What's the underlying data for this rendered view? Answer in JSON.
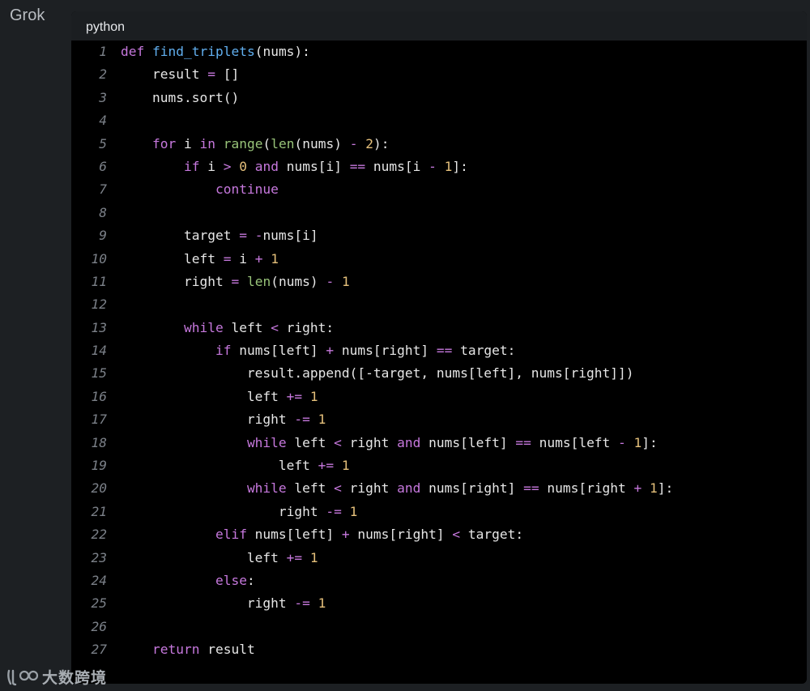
{
  "app": {
    "title": "Grok"
  },
  "code_block": {
    "language": "python",
    "lines": [
      {
        "n": "1",
        "tokens": [
          [
            "kw",
            "def"
          ],
          [
            "plain",
            " "
          ],
          [
            "fn",
            "find_triplets"
          ],
          [
            "plain",
            "(nums):"
          ]
        ]
      },
      {
        "n": "2",
        "tokens": [
          [
            "plain",
            "    result "
          ],
          [
            "op",
            "="
          ],
          [
            "plain",
            " []"
          ]
        ]
      },
      {
        "n": "3",
        "tokens": [
          [
            "plain",
            "    nums.sort()"
          ]
        ]
      },
      {
        "n": "4",
        "tokens": []
      },
      {
        "n": "5",
        "tokens": [
          [
            "plain",
            "    "
          ],
          [
            "kw",
            "for"
          ],
          [
            "plain",
            " i "
          ],
          [
            "kw",
            "in"
          ],
          [
            "plain",
            " "
          ],
          [
            "bi",
            "range"
          ],
          [
            "plain",
            "("
          ],
          [
            "bi",
            "len"
          ],
          [
            "plain",
            "(nums) "
          ],
          [
            "op",
            "-"
          ],
          [
            "plain",
            " "
          ],
          [
            "num",
            "2"
          ],
          [
            "plain",
            "):"
          ]
        ]
      },
      {
        "n": "6",
        "tokens": [
          [
            "plain",
            "        "
          ],
          [
            "kw",
            "if"
          ],
          [
            "plain",
            " i "
          ],
          [
            "op",
            ">"
          ],
          [
            "plain",
            " "
          ],
          [
            "num",
            "0"
          ],
          [
            "plain",
            " "
          ],
          [
            "kw",
            "and"
          ],
          [
            "plain",
            " nums[i] "
          ],
          [
            "op",
            "=="
          ],
          [
            "plain",
            " nums[i "
          ],
          [
            "op",
            "-"
          ],
          [
            "plain",
            " "
          ],
          [
            "num",
            "1"
          ],
          [
            "plain",
            "]:"
          ]
        ]
      },
      {
        "n": "7",
        "tokens": [
          [
            "plain",
            "            "
          ],
          [
            "kw",
            "continue"
          ]
        ]
      },
      {
        "n": "8",
        "tokens": []
      },
      {
        "n": "9",
        "tokens": [
          [
            "plain",
            "        target "
          ],
          [
            "op",
            "="
          ],
          [
            "plain",
            " "
          ],
          [
            "op",
            "-"
          ],
          [
            "plain",
            "nums[i]"
          ]
        ]
      },
      {
        "n": "10",
        "tokens": [
          [
            "plain",
            "        left "
          ],
          [
            "op",
            "="
          ],
          [
            "plain",
            " i "
          ],
          [
            "op",
            "+"
          ],
          [
            "plain",
            " "
          ],
          [
            "num",
            "1"
          ]
        ]
      },
      {
        "n": "11",
        "tokens": [
          [
            "plain",
            "        right "
          ],
          [
            "op",
            "="
          ],
          [
            "plain",
            " "
          ],
          [
            "bi",
            "len"
          ],
          [
            "plain",
            "(nums) "
          ],
          [
            "op",
            "-"
          ],
          [
            "plain",
            " "
          ],
          [
            "num",
            "1"
          ]
        ]
      },
      {
        "n": "12",
        "tokens": []
      },
      {
        "n": "13",
        "tokens": [
          [
            "plain",
            "        "
          ],
          [
            "kw",
            "while"
          ],
          [
            "plain",
            " left "
          ],
          [
            "op",
            "<"
          ],
          [
            "plain",
            " right:"
          ]
        ]
      },
      {
        "n": "14",
        "tokens": [
          [
            "plain",
            "            "
          ],
          [
            "kw",
            "if"
          ],
          [
            "plain",
            " nums[left] "
          ],
          [
            "op",
            "+"
          ],
          [
            "plain",
            " nums[right] "
          ],
          [
            "op",
            "=="
          ],
          [
            "plain",
            " target:"
          ]
        ]
      },
      {
        "n": "15",
        "tokens": [
          [
            "plain",
            "                result.append([-target, nums[left], nums[right]])"
          ]
        ]
      },
      {
        "n": "16",
        "tokens": [
          [
            "plain",
            "                left "
          ],
          [
            "op",
            "+="
          ],
          [
            "plain",
            " "
          ],
          [
            "num",
            "1"
          ]
        ]
      },
      {
        "n": "17",
        "tokens": [
          [
            "plain",
            "                right "
          ],
          [
            "op",
            "-="
          ],
          [
            "plain",
            " "
          ],
          [
            "num",
            "1"
          ]
        ]
      },
      {
        "n": "18",
        "tokens": [
          [
            "plain",
            "                "
          ],
          [
            "kw",
            "while"
          ],
          [
            "plain",
            " left "
          ],
          [
            "op",
            "<"
          ],
          [
            "plain",
            " right "
          ],
          [
            "kw",
            "and"
          ],
          [
            "plain",
            " nums[left] "
          ],
          [
            "op",
            "=="
          ],
          [
            "plain",
            " nums[left "
          ],
          [
            "op",
            "-"
          ],
          [
            "plain",
            " "
          ],
          [
            "num",
            "1"
          ],
          [
            "plain",
            "]:"
          ]
        ]
      },
      {
        "n": "19",
        "tokens": [
          [
            "plain",
            "                    left "
          ],
          [
            "op",
            "+="
          ],
          [
            "plain",
            " "
          ],
          [
            "num",
            "1"
          ]
        ]
      },
      {
        "n": "20",
        "tokens": [
          [
            "plain",
            "                "
          ],
          [
            "kw",
            "while"
          ],
          [
            "plain",
            " left "
          ],
          [
            "op",
            "<"
          ],
          [
            "plain",
            " right "
          ],
          [
            "kw",
            "and"
          ],
          [
            "plain",
            " nums[right] "
          ],
          [
            "op",
            "=="
          ],
          [
            "plain",
            " nums[right "
          ],
          [
            "op",
            "+"
          ],
          [
            "plain",
            " "
          ],
          [
            "num",
            "1"
          ],
          [
            "plain",
            "]:"
          ]
        ]
      },
      {
        "n": "21",
        "tokens": [
          [
            "plain",
            "                    right "
          ],
          [
            "op",
            "-="
          ],
          [
            "plain",
            " "
          ],
          [
            "num",
            "1"
          ]
        ]
      },
      {
        "n": "22",
        "tokens": [
          [
            "plain",
            "            "
          ],
          [
            "kw",
            "elif"
          ],
          [
            "plain",
            " nums[left] "
          ],
          [
            "op",
            "+"
          ],
          [
            "plain",
            " nums[right] "
          ],
          [
            "op",
            "<"
          ],
          [
            "plain",
            " target:"
          ]
        ]
      },
      {
        "n": "23",
        "tokens": [
          [
            "plain",
            "                left "
          ],
          [
            "op",
            "+="
          ],
          [
            "plain",
            " "
          ],
          [
            "num",
            "1"
          ]
        ]
      },
      {
        "n": "24",
        "tokens": [
          [
            "plain",
            "            "
          ],
          [
            "kw",
            "else"
          ],
          [
            "plain",
            ":"
          ]
        ]
      },
      {
        "n": "25",
        "tokens": [
          [
            "plain",
            "                right "
          ],
          [
            "op",
            "-="
          ],
          [
            "plain",
            " "
          ],
          [
            "num",
            "1"
          ]
        ]
      },
      {
        "n": "26",
        "tokens": []
      },
      {
        "n": "27",
        "tokens": [
          [
            "plain",
            "    "
          ],
          [
            "kw",
            "return"
          ],
          [
            "plain",
            " result"
          ]
        ]
      }
    ]
  },
  "watermark": {
    "icon": "logo-mark-icon",
    "text": "大数跨境"
  },
  "colors": {
    "keyword": "#c678dd",
    "function": "#61afef",
    "builtin": "#98c379",
    "number": "#e5c07b",
    "plain": "#e6e6e6",
    "line_number": "#7b8088",
    "code_background": "#000000",
    "page_background": "#1d2023"
  }
}
